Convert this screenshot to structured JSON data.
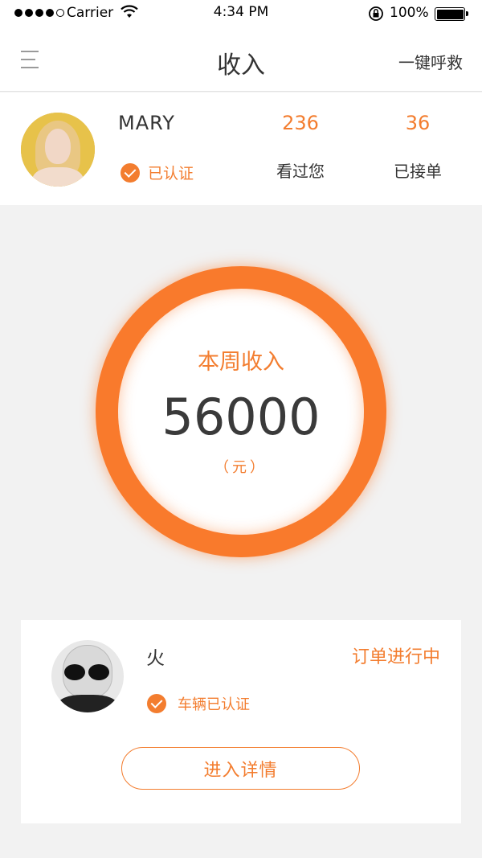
{
  "status_bar": {
    "carrier": "Carrier",
    "time": "4:34 PM",
    "battery": "100%"
  },
  "nav": {
    "title": "收入",
    "right_action": "一键呼救",
    "menu_icon": "menu-icon"
  },
  "profile": {
    "name": "MARY",
    "verified_label": "已认证",
    "stats": [
      {
        "value": "236",
        "label": "看过您"
      },
      {
        "value": "36",
        "label": "已接单"
      }
    ]
  },
  "weekly_income": {
    "label": "本周收入",
    "value": "56000",
    "unit": "（元）"
  },
  "order": {
    "driver_name": "火",
    "status": "订单进行中",
    "car_verified_label": "车辆已认证",
    "detail_button": "进入详情"
  },
  "colors": {
    "accent": "#f37d2f",
    "ring": "#f97a2c",
    "background": "#f2f2f2"
  }
}
